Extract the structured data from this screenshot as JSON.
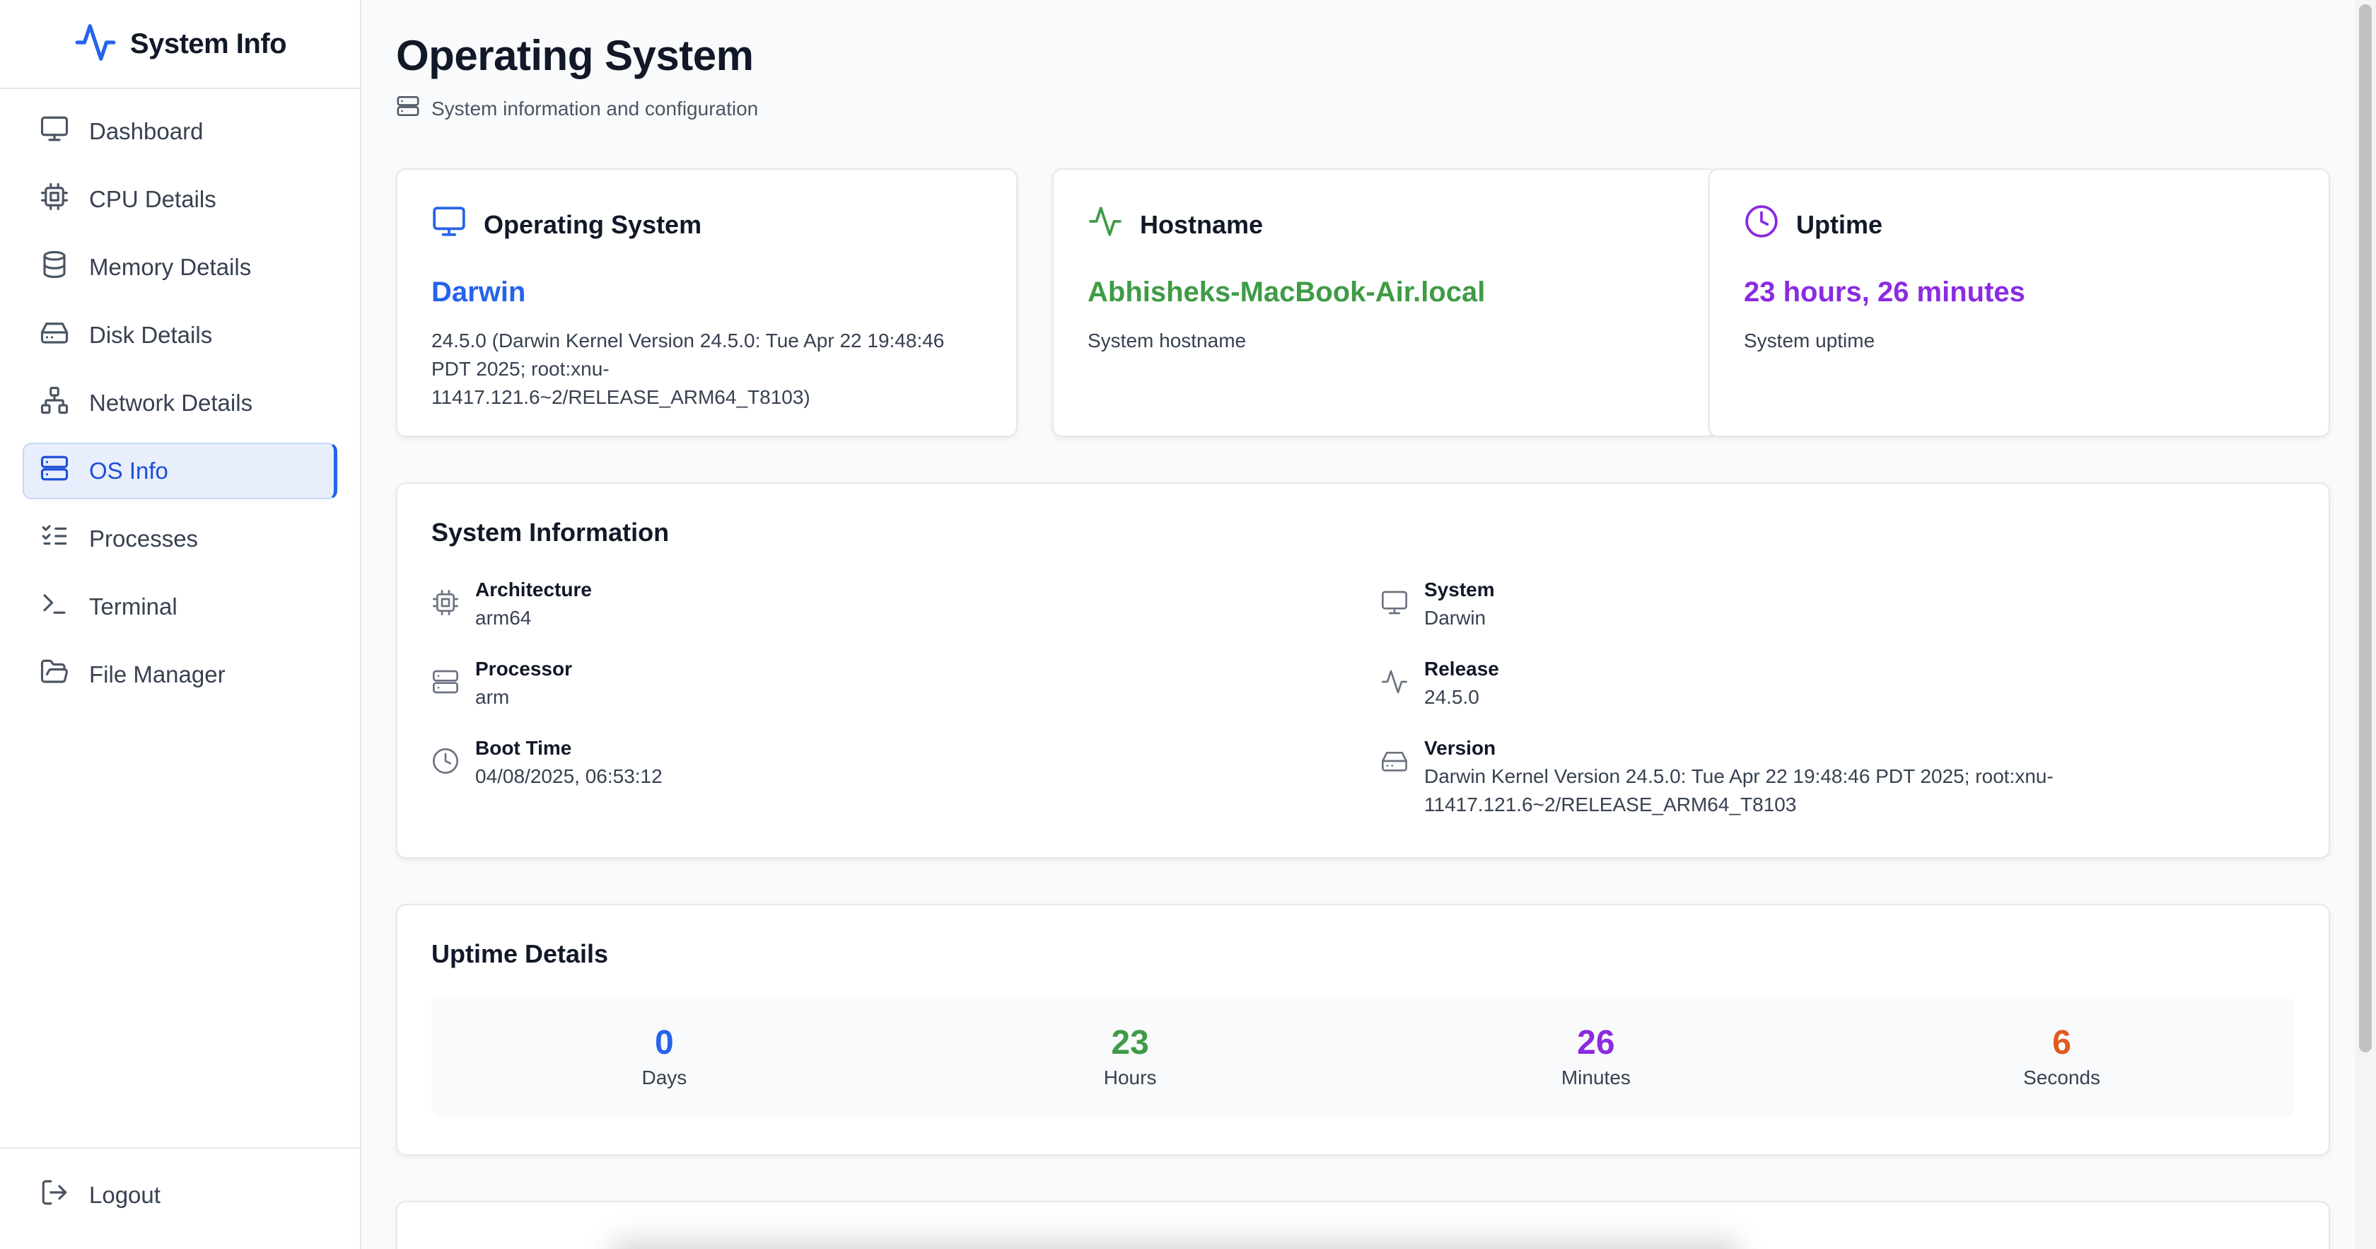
{
  "brand": {
    "title": "System Info"
  },
  "colors": {
    "primary": "#2563eb",
    "green": "#3f9b46",
    "purple": "#8a2be2",
    "orange": "#e05a1e",
    "active_bg": "#e8eefc"
  },
  "sidebar": {
    "items": [
      {
        "label": "Dashboard",
        "icon": "monitor-icon"
      },
      {
        "label": "CPU Details",
        "icon": "cpu-icon"
      },
      {
        "label": "Memory Details",
        "icon": "database-icon"
      },
      {
        "label": "Disk Details",
        "icon": "hard-drive-icon"
      },
      {
        "label": "Network Details",
        "icon": "network-icon"
      },
      {
        "label": "OS Info",
        "icon": "server-icon",
        "active": true
      },
      {
        "label": "Processes",
        "icon": "list-checks-icon"
      },
      {
        "label": "Terminal",
        "icon": "terminal-icon"
      },
      {
        "label": "File Manager",
        "icon": "folder-open-icon"
      }
    ],
    "logout": "Logout"
  },
  "page": {
    "title": "Operating System",
    "subtitle": "System information and configuration"
  },
  "cards": {
    "os": {
      "title": "Operating System",
      "value": "Darwin",
      "desc": "24.5.0 (Darwin Kernel Version 24.5.0: Tue Apr 22 19:48:46 PDT 2025; root:xnu-11417.121.6~2/RELEASE_ARM64_T8103)"
    },
    "hostname": {
      "title": "Hostname",
      "value": "Abhisheks-MacBook-Air.local",
      "desc": "System hostname"
    },
    "uptime": {
      "title": "Uptime",
      "value": "23 hours, 26 minutes",
      "desc": "System uptime"
    }
  },
  "system_information": {
    "title": "System Information",
    "architecture": {
      "label": "Architecture",
      "value": "arm64"
    },
    "processor": {
      "label": "Processor",
      "value": "arm"
    },
    "boot_time": {
      "label": "Boot Time",
      "value": "04/08/2025, 06:53:12"
    },
    "system": {
      "label": "System",
      "value": "Darwin"
    },
    "release": {
      "label": "Release",
      "value": "24.5.0"
    },
    "version": {
      "label": "Version",
      "value": "Darwin Kernel Version 24.5.0: Tue Apr 22 19:48:46 PDT 2025; root:xnu-11417.121.6~2/RELEASE_ARM64_T8103"
    }
  },
  "uptime_details": {
    "title": "Uptime Details",
    "days": {
      "value": "0",
      "label": "Days"
    },
    "hours": {
      "value": "23",
      "label": "Hours"
    },
    "minutes": {
      "value": "26",
      "label": "Minutes"
    },
    "seconds": {
      "value": "6",
      "label": "Seconds"
    }
  }
}
